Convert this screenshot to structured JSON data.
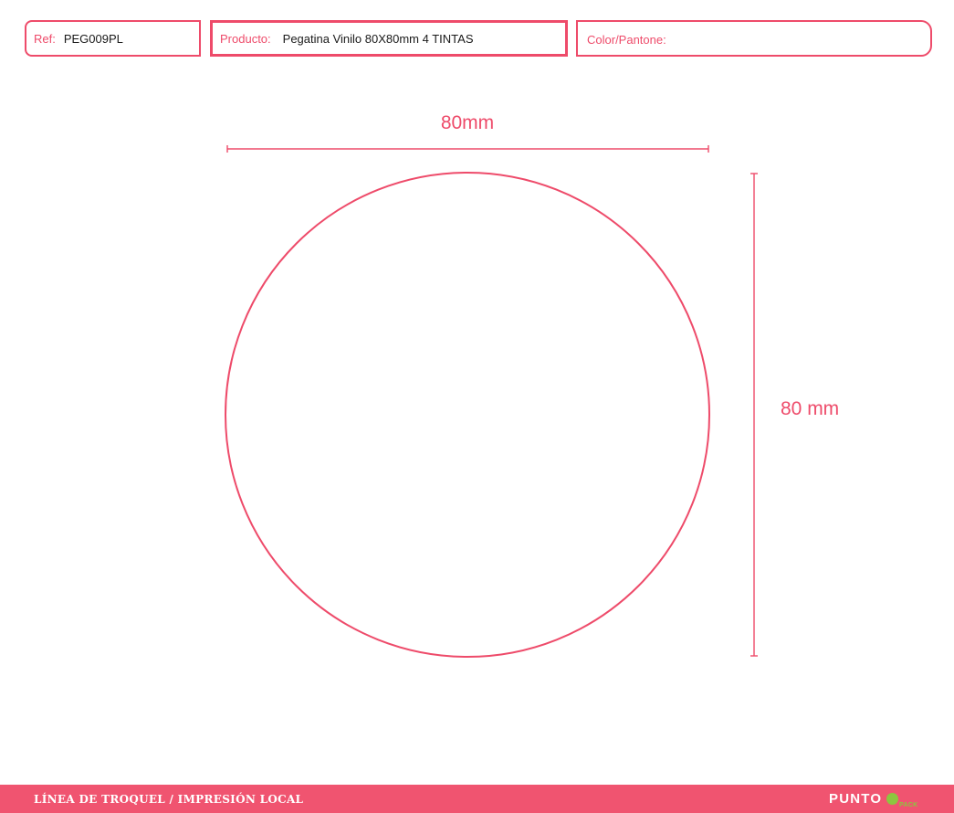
{
  "header": {
    "ref_label": "Ref:",
    "ref_value": "PEG009PL",
    "product_label": "Producto:",
    "product_value": "Pegatina Vinilo 80X80mm 4 TINTAS",
    "color_label": "Color/Pantone:",
    "color_value": ""
  },
  "drawing": {
    "shape": "circle",
    "width_label": "80mm",
    "height_label": "80 mm",
    "stroke_color": "#ee4b6a"
  },
  "footer": {
    "title": "LÍNEA DE TROQUEL / IMPRESIÓN LOCAL",
    "brand_name": "PUNTO",
    "brand_sub": "PACK",
    "bar_color": "#f05470",
    "brand_accent": "#8cc63f"
  }
}
